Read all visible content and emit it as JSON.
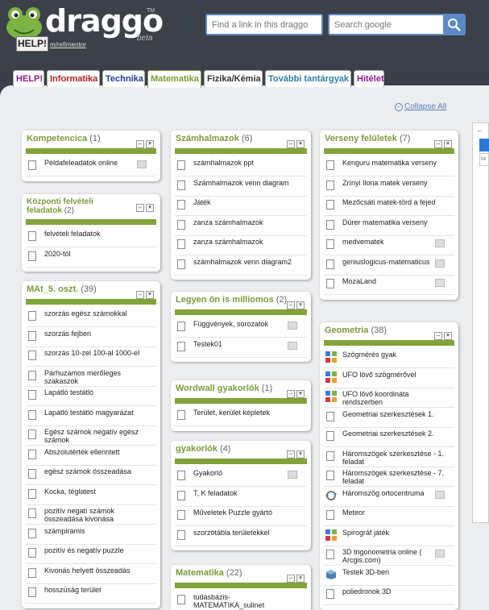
{
  "header": {
    "logo_text": "draggo",
    "logo_tm": "TM",
    "logo_beta": "beta",
    "help_label": "HELP!",
    "user_link": "m/refimentor",
    "find_placeholder": "Find a link in this draggo",
    "google_placeholder": "Search google"
  },
  "tabs": [
    {
      "label": "HELP!",
      "color": "#8b1a8b"
    },
    {
      "label": "Informatika",
      "color": "#b52020"
    },
    {
      "label": "Technika",
      "color": "#1a3a9c"
    },
    {
      "label": "Matematika",
      "color": "#7a9b3a"
    },
    {
      "label": "Fizika/Kémia",
      "color": "#333333"
    },
    {
      "label": "További tantárgyak",
      "color": "#2e7d9e"
    },
    {
      "label": "Hitélet",
      "color": "#8b1a8b"
    }
  ],
  "collapse_all_label": "Collapse All",
  "widgets": {
    "kompetencia": {
      "title": "Kompetencica",
      "count": "(1)",
      "items": [
        "Példafeleadatok online"
      ]
    },
    "kozponti": {
      "title": "Központi felvételi feladatok",
      "count": "(2)",
      "items": [
        "felvételi feladatok",
        "2020-tól"
      ]
    },
    "mat5": {
      "title": "MAt_5. oszt.",
      "count": "(39)",
      "items": [
        "szorzás egész számokkal",
        "szorzás fejben",
        "szorzás 10-zel 100-al 1000-el",
        "Párhuzamos merőleges szakaszok",
        "Lapátló testátló",
        "Lapátló testátló magyarázat",
        "Egész számok negatív egész számok",
        "Abszolutérték ellenntett",
        "egész számok összeadása",
        "Kocka, téglatest",
        "pozitív negatí számok összeadása kivonása",
        "számpiramis",
        "pozitív és negatív puzzle",
        "Kivonás helyett összeadás",
        "hosszúság terület"
      ]
    },
    "szamhalmazok": {
      "title": "Számhalmazok",
      "count": "(6)",
      "items": [
        "számhalmazok ppt",
        "Számhalmazok venn diagram",
        "Játék",
        "zanza számhalmazok",
        "zanza számhalmazok",
        "számhalmazok venn diagram2"
      ]
    },
    "legyen": {
      "title": "Legyen ön is milliomos",
      "count": "(2)",
      "items": [
        "Függvények, sorozatok",
        "Testek01"
      ]
    },
    "wordwall": {
      "title": "Wordwall gyakorlók",
      "count": "(1)",
      "items": [
        "Terület, kerület képletek"
      ]
    },
    "gyakorlok": {
      "title": "gyakorlók",
      "count": "(4)",
      "items": [
        "Gyakorló",
        "T, K feladatok",
        "Műveletek Puzzle gyártó",
        "szorzótábla területekkel"
      ]
    },
    "matematika": {
      "title": "Matematika",
      "count": "(22)",
      "items": [
        "tudásbázis-MATEMATIKA_sulinet"
      ]
    },
    "verseny": {
      "title": "Verseny felületek",
      "count": "(7)",
      "items": [
        "Kenguru matematika verseny",
        "Zrínyi Ilona matek verseny",
        "Mezőcsáti matek-törd a fejed",
        "Dürer matematika verseny",
        "medvematek",
        "geniuslogicus-matematicus",
        "MozaLand"
      ]
    },
    "geometria": {
      "title": "Geometria",
      "count": "(38)",
      "items": [
        "Szögmérés gyak",
        "UFO lövő szögmérővel",
        "UFO lövő koordináta rendszerben",
        "Geometriai szerkesztések 1.",
        "Geometriai szerkesztések 2.",
        "Háromszögek szerkesztése - 1. feladat",
        "Háromszögek szerkesztése - 7. feladat",
        "Háromszög ortocentruma",
        "Meteor",
        "Spirográf játék",
        "3D trigonometria online ( Arcgis.com)",
        "Testek 3D-ben",
        "poliedronok 3D"
      ]
    }
  },
  "right_panel": {
    "arrow": "←",
    "box_text": "Mi"
  }
}
